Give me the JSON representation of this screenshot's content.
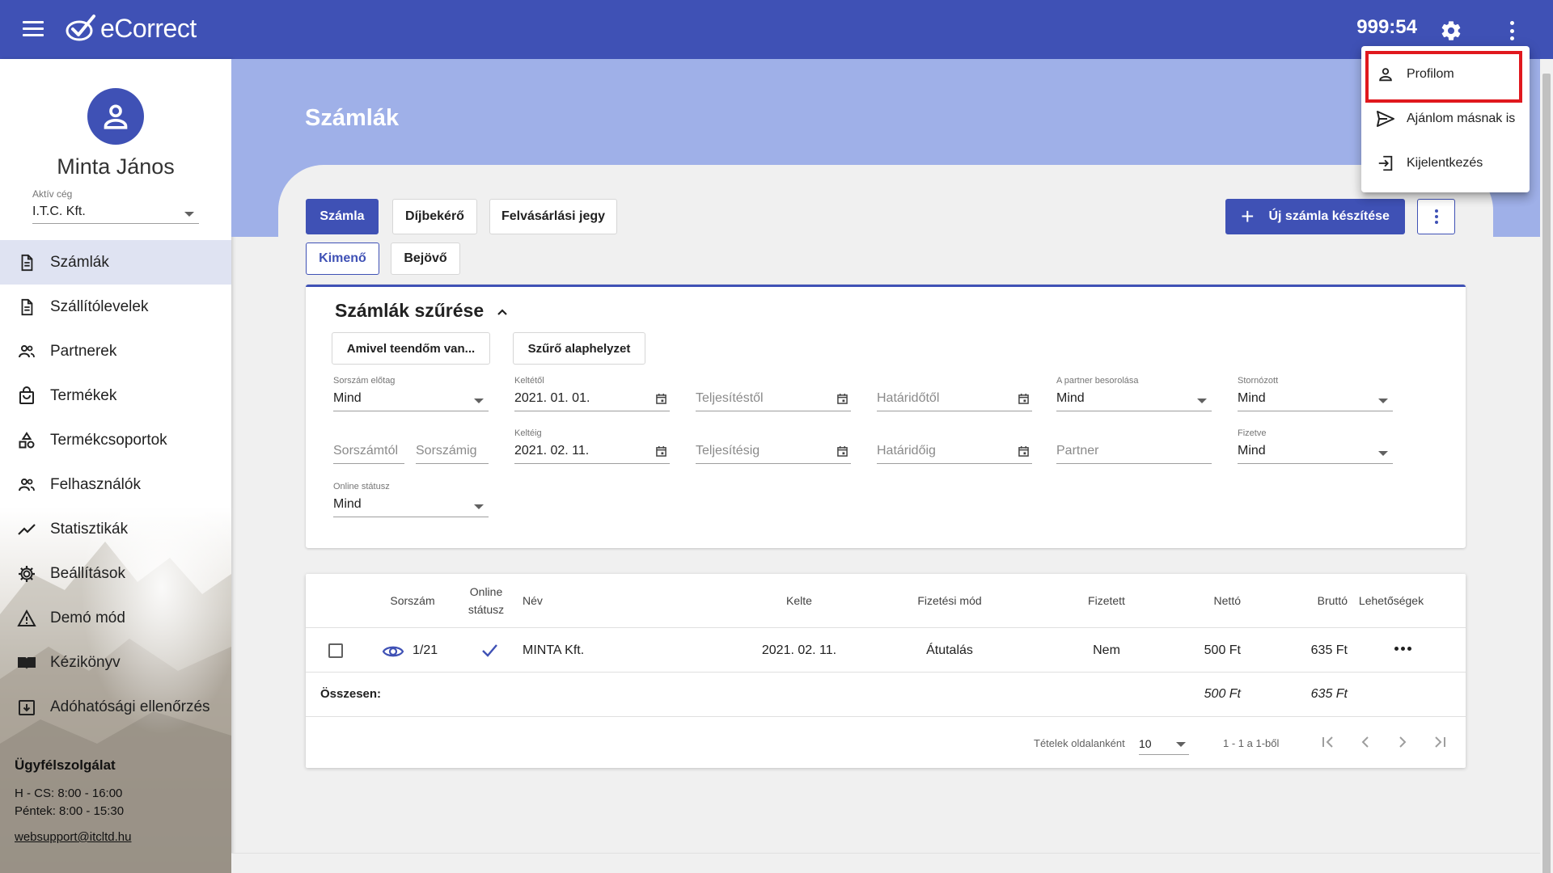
{
  "header": {
    "app_name": "eCorrect",
    "timer": "999:54"
  },
  "user_menu": {
    "items": [
      {
        "label": "Profilom",
        "icon": "person-icon"
      },
      {
        "label": "Ajánlom másnak is",
        "icon": "send-icon"
      },
      {
        "label": "Kijelentkezés",
        "icon": "logout-icon"
      }
    ]
  },
  "sidebar": {
    "user_name": "Minta János",
    "company_label": "Aktív cég",
    "company_value": "I.T.C. Kft.",
    "items": [
      {
        "label": "Számlák",
        "icon": "document-icon",
        "active": true
      },
      {
        "label": "Szállítólevelek",
        "icon": "document-icon"
      },
      {
        "label": "Partnerek",
        "icon": "people-icon"
      },
      {
        "label": "Termékek",
        "icon": "shopping-bag-icon"
      },
      {
        "label": "Termékcsoportok",
        "icon": "category-icon"
      },
      {
        "label": "Felhasználók",
        "icon": "people-icon"
      },
      {
        "label": "Statisztikák",
        "icon": "trending-icon"
      },
      {
        "label": "Beállítások",
        "icon": "gear-icon"
      },
      {
        "label": "Demó mód",
        "icon": "warning-icon"
      },
      {
        "label": "Kézikönyv",
        "icon": "book-icon"
      },
      {
        "label": "Adóhatósági ellenőrzés",
        "icon": "archive-icon"
      }
    ],
    "support": {
      "title": "Ügyfélszolgálat",
      "hours_1": "H - CS: 8:00 - 16:00",
      "hours_2": "Péntek: 8:00 - 15:30",
      "email": "websupport@itcltd.hu"
    }
  },
  "main": {
    "title": "Számlák",
    "doc_tabs": [
      "Számla",
      "Díjbekérő",
      "Felvásárlási jegy"
    ],
    "direction_tabs": [
      "Kimenő",
      "Bejövő"
    ],
    "new_button": "Új számla készítése"
  },
  "filter": {
    "title": "Számlák szűrése",
    "btn_todo": "Amivel teendőm van...",
    "btn_reset": "Szűrő alaphelyzet",
    "prefix_label": "Sorszám előtag",
    "prefix_value": "Mind",
    "date_from_label": "Keltétől",
    "date_from_value": "2021. 01. 01.",
    "fulfil_from_ph": "Teljesítéstől",
    "due_from_ph": "Határidőtől",
    "partner_class_label": "A partner besorolása",
    "partner_class_value": "Mind",
    "storno_label": "Stornózott",
    "storno_value": "Mind",
    "num_from_ph": "Sorszámtól",
    "num_to_ph": "Sorszámig",
    "date_to_label": "Keltéig",
    "date_to_value": "2021. 02. 11.",
    "fulfil_to_ph": "Teljesítésig",
    "due_to_ph": "Határidőig",
    "partner_ph": "Partner",
    "paid_label": "Fizetve",
    "paid_value": "Mind",
    "online_label": "Online státusz",
    "online_value": "Mind"
  },
  "table": {
    "columns": {
      "number": "Sorszám",
      "online_1": "Online",
      "online_2": "státusz",
      "name": "Név",
      "date": "Kelte",
      "payment": "Fizetési mód",
      "paid": "Fizetett",
      "net": "Nettó",
      "gross": "Bruttó",
      "options": "Lehetőségek"
    },
    "rows": [
      {
        "number": "1/21",
        "name": "MINTA Kft.",
        "date": "2021. 02. 11.",
        "payment": "Átutalás",
        "paid": "Nem",
        "net": "500 Ft",
        "gross": "635 Ft"
      }
    ],
    "total_label": "Összesen:",
    "total_net": "500 Ft",
    "total_gross": "635 Ft",
    "pager": {
      "per_page_label": "Tételek oldalanként",
      "per_page_value": "10",
      "range": "1 - 1 a 1-ből"
    }
  }
}
